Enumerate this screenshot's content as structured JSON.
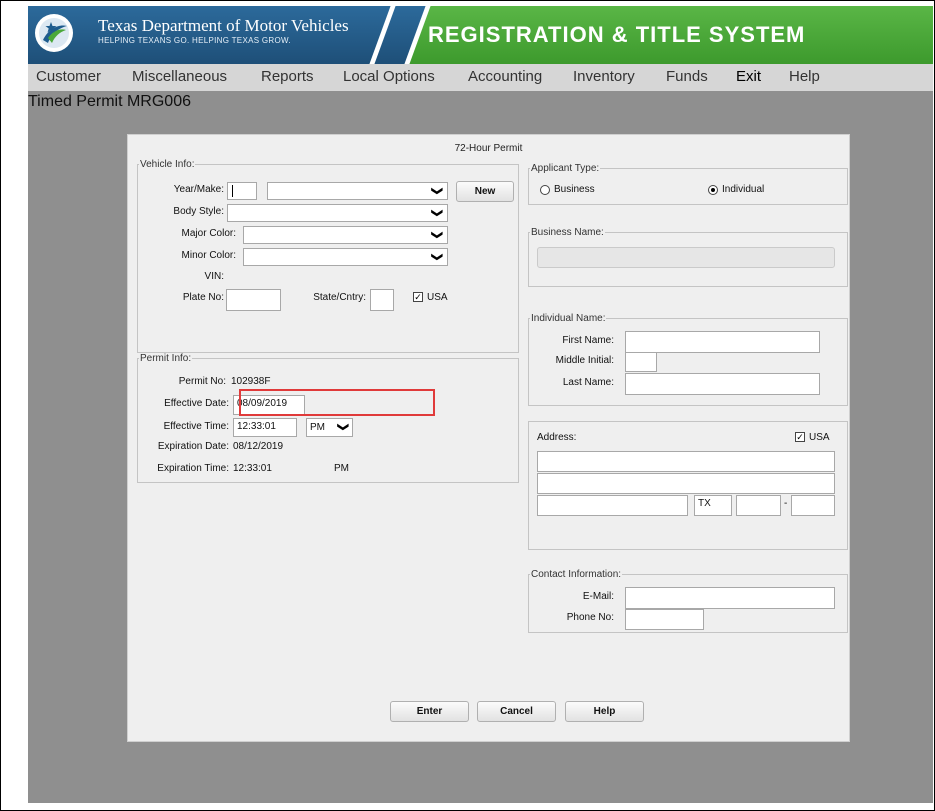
{
  "header": {
    "org_title": "Texas Department of Motor Vehicles",
    "org_subtitle": "HELPING TEXANS GO. HELPING TEXAS GROW.",
    "system_title": "REGISTRATION & TITLE SYSTEM"
  },
  "menu": [
    "Customer",
    "Miscellaneous",
    "Reports",
    "Local Options",
    "Accounting",
    "Inventory",
    "Funds",
    "Exit",
    "Help"
  ],
  "screen_title": "Timed Permit MRG006",
  "dialog": {
    "title": "72-Hour Permit",
    "vehicle": {
      "legend": "Vehicle Info:",
      "year_make_label": "Year/Make:",
      "body_style_label": "Body Style:",
      "major_color_label": "Major Color:",
      "minor_color_label": "Minor Color:",
      "vin_label": "VIN:",
      "plate_label": "Plate No:",
      "state_label": "State/Cntry:",
      "usa_label": "USA",
      "new_button": "New"
    },
    "permit": {
      "legend": "Permit Info:",
      "permit_no_label": "Permit No:",
      "permit_no": "102938F",
      "effective_date_label": "Effective Date:",
      "effective_date": "08/09/2019",
      "effective_time_label": "Effective Time:",
      "effective_time": "12:33:01",
      "ampm": "PM",
      "expiration_date_label": "Expiration Date:",
      "expiration_date": "08/12/2019",
      "expiration_time_label": "Expiration Time:",
      "expiration_time": "12:33:01",
      "expiration_ampm": "PM"
    },
    "applicant": {
      "legend": "Applicant Type:",
      "business": "Business",
      "individual": "Individual",
      "selected": "Individual"
    },
    "business_name": {
      "legend": "Business Name:"
    },
    "individual": {
      "legend": "Individual Name:",
      "first_label": "First Name:",
      "middle_label": "Middle Initial:",
      "last_label": "Last Name:"
    },
    "address": {
      "label": "Address:",
      "usa_label": "USA",
      "state": "TX",
      "zip_sep": "-"
    },
    "contact": {
      "legend": "Contact Information:",
      "email_label": "E-Mail:",
      "phone_label": "Phone No:"
    },
    "buttons": {
      "enter": "Enter",
      "cancel": "Cancel",
      "help": "Help"
    }
  },
  "colors": {
    "header_blue": "#1e4f78",
    "header_green": "#3d9a2d",
    "workspace": "#8f8f8f",
    "highlight": "#e03a3a"
  }
}
